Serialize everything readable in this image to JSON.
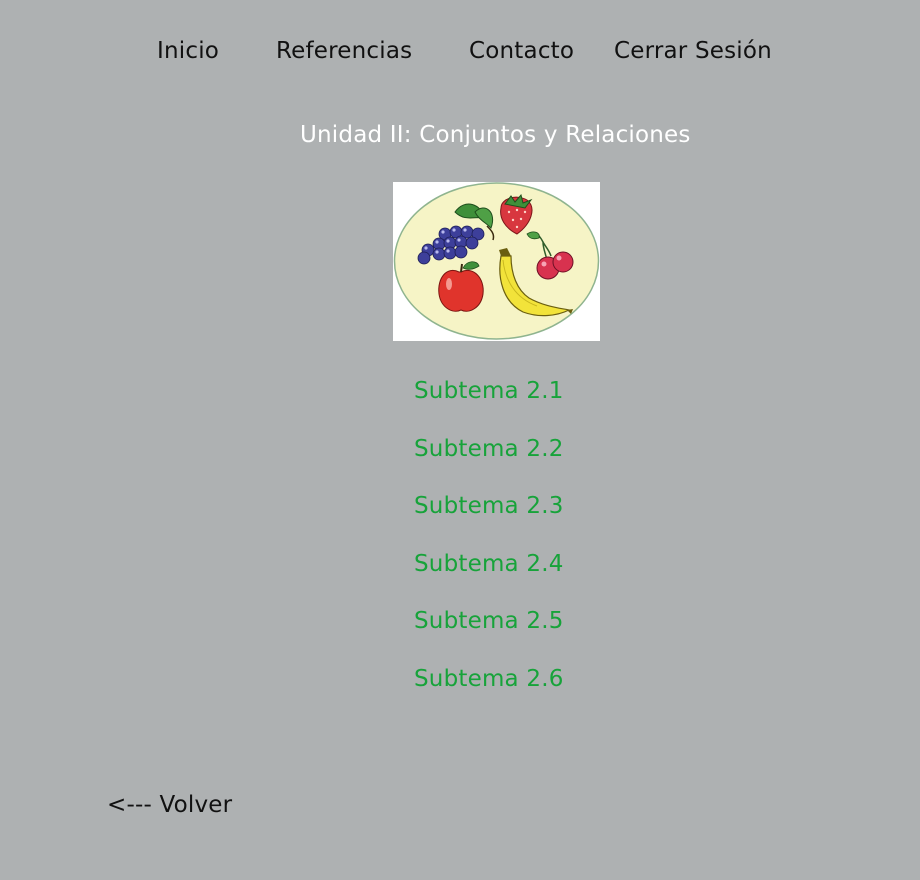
{
  "nav": {
    "items": [
      {
        "label": "Inicio"
      },
      {
        "label": "Referencias"
      },
      {
        "label": "Contacto"
      },
      {
        "label": "Cerrar Sesión"
      }
    ]
  },
  "page": {
    "title": "Unidad II: Conjuntos y Relaciones",
    "image_icon": "fruit-plate-image"
  },
  "subtopics": [
    {
      "label": "Subtema 2.1"
    },
    {
      "label": "Subtema 2.2"
    },
    {
      "label": "Subtema 2.3"
    },
    {
      "label": "Subtema 2.4"
    },
    {
      "label": "Subtema 2.5"
    },
    {
      "label": "Subtema 2.6"
    }
  ],
  "back_link": {
    "label": "<--- Volver"
  },
  "colors": {
    "background": "#aeb1b2",
    "nav_text": "#111111",
    "title_text": "#ffffff",
    "subtopic_link": "#17a33a"
  }
}
